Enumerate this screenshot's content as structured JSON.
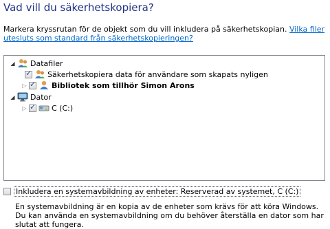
{
  "title": "Vad vill du säkerhetskopiera?",
  "intro": {
    "text": "Markera kryssrutan för de objekt som du vill inkludera på säkerhetskopian. ",
    "link": "Vilka filer utesluts som standard från säkerhetskopieringen?"
  },
  "tree": {
    "datafiler": "Datafiler",
    "item_users": "Säkerhetskopiera data för användare som skapats nyligen",
    "item_library": "Bibliotek som tillhör Simon Arons",
    "dator": "Dator",
    "drive_c": "C (C:)"
  },
  "system_image": {
    "label": "Inkludera en systemavbildning av enheter: Reserverad av systemet, C (C:)",
    "checked": false
  },
  "description": "En systemavbildning är en kopia av de enheter som krävs för att köra Windows. Du kan använda en systemavbildning om du behöver återställa en dator som har slutat att fungera.",
  "colors": {
    "title": "#1e3287",
    "link": "#0066cc",
    "border": "#828790"
  }
}
